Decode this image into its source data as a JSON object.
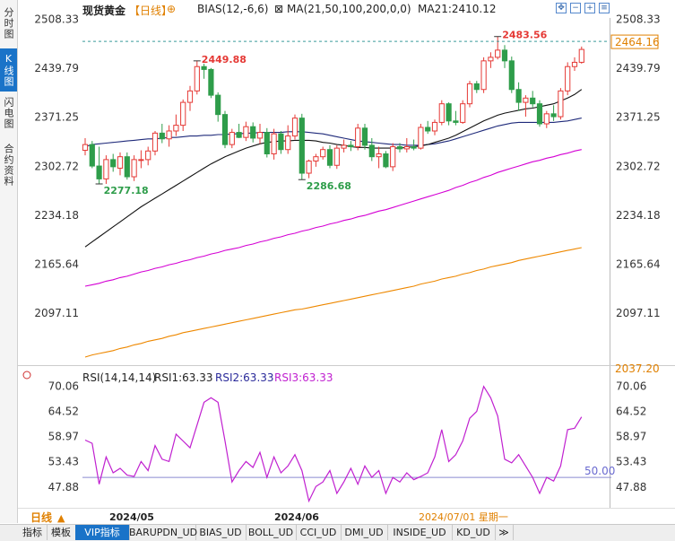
{
  "left_tabs": [
    "分时图",
    "K线图",
    "闪电图",
    "合约资料"
  ],
  "left_tab_active": 1,
  "header": {
    "symbol": "现货黄金",
    "period": "【日线】",
    "bias_label": "BIAS(12,-6,6)",
    "ma_label": "MA(21,50,100,200,0,0)",
    "ma21_label": "MA21:2410.12"
  },
  "rsi_header": {
    "name": "RSI(14,14,14)",
    "rsi1": "RSI1:63.33",
    "rsi2": "RSI2:63.33",
    "rsi3": "RSI3:63.33"
  },
  "period_selector": "日线",
  "bottom_tabs": [
    "指标",
    "模板",
    "VIP指标",
    "BARUPDN_UD",
    "BIAS_UD",
    "BOLL_UD",
    "CCI_UD",
    "DMI_UD",
    "INSIDE_UD",
    "KD_UD",
    "≫"
  ],
  "bottom_tab_active": 2,
  "colors": {
    "up": "#e53935",
    "down": "#2e9d4a",
    "ma21": "#111111",
    "ma50": "#1f2a7a",
    "ma100": "#d400d4",
    "ma200": "#ee8800",
    "rsi": "#c020d0",
    "rsi_ref": "#8a8ad0"
  },
  "chart_data": [
    {
      "type": "candlestick",
      "title": "现货黄金 日线",
      "ylim": [
        2037.2,
        2510
      ],
      "y_ticks": [
        "2508.33",
        "2439.79",
        "2371.25",
        "2302.72",
        "2234.18",
        "2165.64",
        "2097.11"
      ],
      "y_bottom_label": "2037.20",
      "x_labels": [
        "2024/05",
        "2024/06",
        "2024/07/01 星期一"
      ],
      "last_price_label": "2464.16",
      "last_price": 2466,
      "annotations": [
        {
          "text": "2449.88",
          "type": "high"
        },
        {
          "text": "2277.18",
          "type": "low"
        },
        {
          "text": "2286.68",
          "type": "low"
        },
        {
          "text": "2483.56",
          "type": "high"
        }
      ],
      "candles": [
        [
          2325,
          2342,
          2318,
          2333
        ],
        [
          2333,
          2338,
          2300,
          2303
        ],
        [
          2303,
          2330,
          2278,
          2285
        ],
        [
          2285,
          2318,
          2278,
          2312
        ],
        [
          2312,
          2320,
          2295,
          2302
        ],
        [
          2300,
          2322,
          2290,
          2316
        ],
        [
          2316,
          2322,
          2284,
          2288
        ],
        [
          2288,
          2318,
          2282,
          2312
        ],
        [
          2312,
          2325,
          2300,
          2312
        ],
        [
          2312,
          2330,
          2304,
          2324
        ],
        [
          2324,
          2352,
          2318,
          2349
        ],
        [
          2349,
          2362,
          2335,
          2341
        ],
        [
          2341,
          2360,
          2330,
          2352
        ],
        [
          2352,
          2375,
          2345,
          2360
        ],
        [
          2360,
          2396,
          2352,
          2392
        ],
        [
          2392,
          2415,
          2380,
          2408
        ],
        [
          2408,
          2450,
          2403,
          2442
        ],
        [
          2442,
          2446,
          2425,
          2438
        ],
        [
          2438,
          2440,
          2398,
          2402
        ],
        [
          2402,
          2406,
          2365,
          2375
        ],
        [
          2375,
          2380,
          2328,
          2333
        ],
        [
          2333,
          2355,
          2328,
          2350
        ],
        [
          2350,
          2362,
          2342,
          2343
        ],
        [
          2343,
          2365,
          2338,
          2358
        ],
        [
          2358,
          2364,
          2336,
          2342
        ],
        [
          2342,
          2362,
          2334,
          2350
        ],
        [
          2350,
          2356,
          2315,
          2320
        ],
        [
          2320,
          2355,
          2312,
          2348
        ],
        [
          2348,
          2352,
          2320,
          2326
        ],
        [
          2326,
          2360,
          2320,
          2345
        ],
        [
          2345,
          2375,
          2340,
          2370
        ],
        [
          2370,
          2376,
          2284,
          2293
        ],
        [
          2293,
          2312,
          2286,
          2310
        ],
        [
          2310,
          2320,
          2302,
          2316
        ],
        [
          2316,
          2330,
          2312,
          2326
        ],
        [
          2326,
          2332,
          2300,
          2304
        ],
        [
          2304,
          2332,
          2299,
          2328
        ],
        [
          2328,
          2340,
          2322,
          2332
        ],
        [
          2332,
          2338,
          2324,
          2330
        ],
        [
          2330,
          2362,
          2325,
          2356
        ],
        [
          2356,
          2362,
          2326,
          2332
        ],
        [
          2332,
          2342,
          2310,
          2316
        ],
        [
          2316,
          2330,
          2300,
          2320
        ],
        [
          2320,
          2324,
          2300,
          2302
        ],
        [
          2302,
          2335,
          2296,
          2330
        ],
        [
          2330,
          2335,
          2322,
          2327
        ],
        [
          2327,
          2342,
          2322,
          2330
        ],
        [
          2330,
          2340,
          2325,
          2328
        ],
        [
          2328,
          2362,
          2326,
          2357
        ],
        [
          2357,
          2366,
          2348,
          2352
        ],
        [
          2352,
          2368,
          2346,
          2364
        ],
        [
          2364,
          2395,
          2360,
          2390
        ],
        [
          2390,
          2392,
          2360,
          2366
        ],
        [
          2366,
          2380,
          2360,
          2364
        ],
        [
          2364,
          2395,
          2362,
          2390
        ],
        [
          2390,
          2422,
          2385,
          2418
        ],
        [
          2418,
          2422,
          2405,
          2410
        ],
        [
          2410,
          2455,
          2405,
          2450
        ],
        [
          2450,
          2462,
          2440,
          2455
        ],
        [
          2455,
          2484,
          2452,
          2465
        ],
        [
          2465,
          2472,
          2440,
          2450
        ],
        [
          2450,
          2456,
          2405,
          2410
        ],
        [
          2410,
          2420,
          2380,
          2392
        ],
        [
          2392,
          2402,
          2372,
          2398
        ],
        [
          2398,
          2408,
          2385,
          2390
        ],
        [
          2390,
          2395,
          2358,
          2362
        ],
        [
          2362,
          2380,
          2356,
          2376
        ],
        [
          2376,
          2388,
          2366,
          2372
        ],
        [
          2372,
          2412,
          2368,
          2408
        ],
        [
          2408,
          2448,
          2402,
          2442
        ],
        [
          2442,
          2455,
          2436,
          2448
        ],
        [
          2448,
          2470,
          2446,
          2466
        ]
      ],
      "ma21": [
        2190,
        2197,
        2204,
        2211,
        2218,
        2225,
        2232,
        2239,
        2246,
        2252,
        2258,
        2264,
        2270,
        2276,
        2282,
        2288,
        2294,
        2300,
        2306,
        2311,
        2316,
        2320,
        2324,
        2328,
        2331,
        2334,
        2336,
        2337,
        2338,
        2338,
        2339,
        2339,
        2339,
        2338,
        2336,
        2335,
        2333,
        2332,
        2330,
        2329,
        2329,
        2328,
        2328,
        2328,
        2328,
        2328,
        2329,
        2330,
        2331,
        2333,
        2336,
        2339,
        2342,
        2346,
        2351,
        2356,
        2361,
        2366,
        2370,
        2374,
        2377,
        2379,
        2381,
        2383,
        2384,
        2386,
        2388,
        2390,
        2394,
        2398,
        2403,
        2410
      ],
      "ma50": [
        2330,
        2333,
        2334,
        2335,
        2336,
        2337,
        2338,
        2339,
        2340,
        2341,
        2341,
        2342,
        2343,
        2343,
        2344,
        2345,
        2345,
        2346,
        2346,
        2347,
        2347,
        2348,
        2348,
        2349,
        2349,
        2350,
        2350,
        2350,
        2350,
        2351,
        2351,
        2351,
        2350,
        2349,
        2348,
        2346,
        2344,
        2342,
        2340,
        2338,
        2337,
        2336,
        2335,
        2334,
        2333,
        2333,
        2332,
        2332,
        2332,
        2333,
        2334,
        2336,
        2338,
        2341,
        2344,
        2347,
        2350,
        2353,
        2356,
        2359,
        2361,
        2363,
        2364,
        2364,
        2364,
        2364,
        2364,
        2364,
        2365,
        2366,
        2368,
        2370
      ],
      "ma100": [
        2135,
        2137,
        2139,
        2142,
        2144,
        2147,
        2149,
        2152,
        2155,
        2157,
        2160,
        2162,
        2165,
        2167,
        2170,
        2172,
        2175,
        2177,
        2180,
        2182,
        2185,
        2187,
        2189,
        2192,
        2194,
        2197,
        2199,
        2202,
        2204,
        2207,
        2209,
        2212,
        2214,
        2217,
        2219,
        2222,
        2224,
        2227,
        2229,
        2232,
        2234,
        2237,
        2240,
        2242,
        2245,
        2248,
        2251,
        2254,
        2257,
        2260,
        2263,
        2266,
        2269,
        2273,
        2276,
        2280,
        2283,
        2287,
        2290,
        2294,
        2297,
        2300,
        2303,
        2306,
        2309,
        2311,
        2314,
        2316,
        2319,
        2321,
        2324,
        2326
      ],
      "ma200": [
        2036,
        2039,
        2041,
        2043,
        2045,
        2048,
        2050,
        2053,
        2055,
        2058,
        2060,
        2062,
        2065,
        2067,
        2070,
        2072,
        2074,
        2076,
        2078,
        2080,
        2082,
        2084,
        2086,
        2088,
        2090,
        2092,
        2094,
        2096,
        2098,
        2100,
        2102,
        2103,
        2105,
        2107,
        2109,
        2111,
        2113,
        2115,
        2117,
        2119,
        2121,
        2123,
        2125,
        2127,
        2129,
        2131,
        2133,
        2135,
        2138,
        2140,
        2142,
        2145,
        2147,
        2149,
        2152,
        2154,
        2157,
        2159,
        2162,
        2164,
        2166,
        2168,
        2171,
        2173,
        2175,
        2177,
        2179,
        2181,
        2183,
        2185,
        2187,
        2189
      ]
    },
    {
      "type": "line",
      "title": "RSI(14,14,14)",
      "ylim": [
        44.5,
        72.5
      ],
      "y_ticks": [
        "70.06",
        "64.52",
        "58.97",
        "53.43",
        "47.88"
      ],
      "ref_line": 50,
      "ref_label": "50.00",
      "series": [
        {
          "name": "RSI1",
          "values": [
            58.2,
            57.5,
            48.5,
            54.5,
            51.0,
            52.0,
            50.5,
            50.2,
            53.5,
            51.5,
            57.0,
            54.0,
            53.5,
            59.5,
            58.0,
            56.5,
            61.5,
            66.5,
            67.5,
            66.5,
            58.0,
            49.0,
            51.5,
            53.5,
            52.2,
            55.5,
            50.0,
            54.5,
            51.0,
            52.5,
            55.0,
            51.5,
            44.8,
            48.0,
            49.0,
            51.5,
            46.5,
            49.0,
            52.0,
            48.5,
            52.5,
            50.0,
            51.5,
            46.5,
            50.0,
            49.0,
            51.0,
            49.5,
            50.2,
            51.0,
            54.5,
            60.5,
            53.5,
            55.0,
            58.0,
            63.0,
            64.5,
            70.0,
            67.5,
            63.5,
            54.0,
            53.2,
            55.0,
            52.5,
            50.0,
            46.5,
            50.0,
            49.2,
            52.5,
            60.5,
            60.8,
            63.3
          ]
        }
      ]
    }
  ]
}
